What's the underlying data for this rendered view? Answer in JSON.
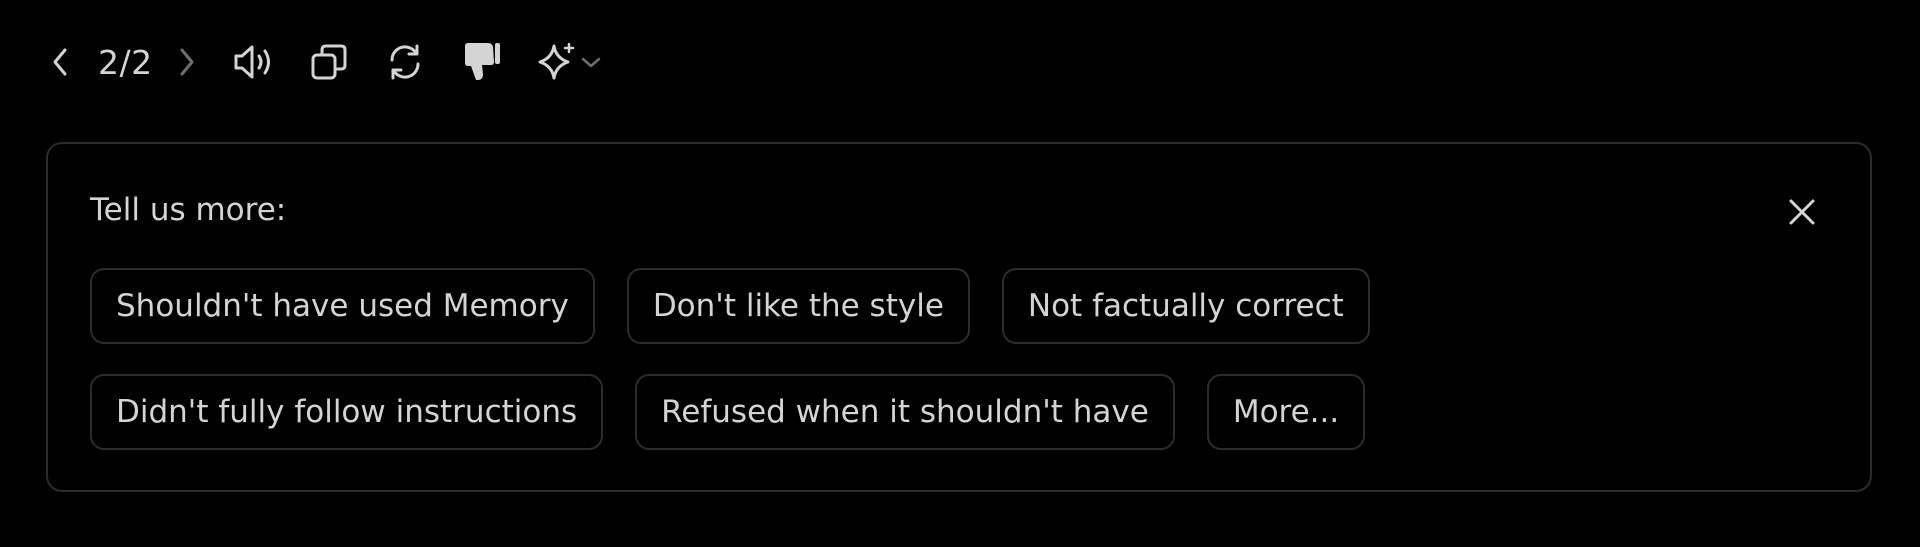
{
  "toolbar": {
    "pager": "2/2",
    "icons": [
      "chevron-left-icon",
      "chevron-right-icon",
      "speaker-icon",
      "copy-icon",
      "regenerate-icon",
      "thumbs-down-icon",
      "sparkle-icon",
      "chevron-down-icon"
    ]
  },
  "feedback": {
    "title": "Tell us more:",
    "rows": [
      [
        "Shouldn't have used Memory",
        "Don't like the style",
        "Not factually correct"
      ],
      [
        "Didn't fully follow instructions",
        "Refused when it shouldn't have",
        "More..."
      ]
    ]
  },
  "colors": {
    "background": "#000000",
    "border": "#2c2c2c",
    "text": "#d4d4d4"
  }
}
